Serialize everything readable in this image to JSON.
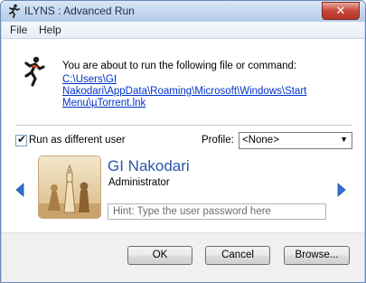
{
  "window": {
    "title": "ILYNS : Advanced Run",
    "close_glyph": "✕"
  },
  "menu": {
    "items": [
      {
        "label": "File"
      },
      {
        "label": "Help"
      }
    ]
  },
  "header": {
    "intro": "You are about to run the following file or command:",
    "path_line1": "C:\\Users\\GI Nakodari\\AppData\\Roaming\\Microsoft\\Windows\\Start",
    "path_line2": "Menu\\µTorrent.lnk",
    "icon": "runner-icon"
  },
  "options": {
    "run_as_label": "Run as different user",
    "run_as_checked": true,
    "profile_label": "Profile:",
    "profile_value": "<None>"
  },
  "user": {
    "name": "GI Nakodari",
    "role": "Administrator",
    "avatar_icon": "chess-pieces-avatar",
    "password_placeholder": "Hint: Type the user password here",
    "password_value": ""
  },
  "buttons": {
    "ok": "OK",
    "cancel": "Cancel",
    "browse": "Browse..."
  },
  "colors": {
    "accent": "#2a56a6",
    "link": "#0033cc",
    "close": "#c8473a"
  }
}
